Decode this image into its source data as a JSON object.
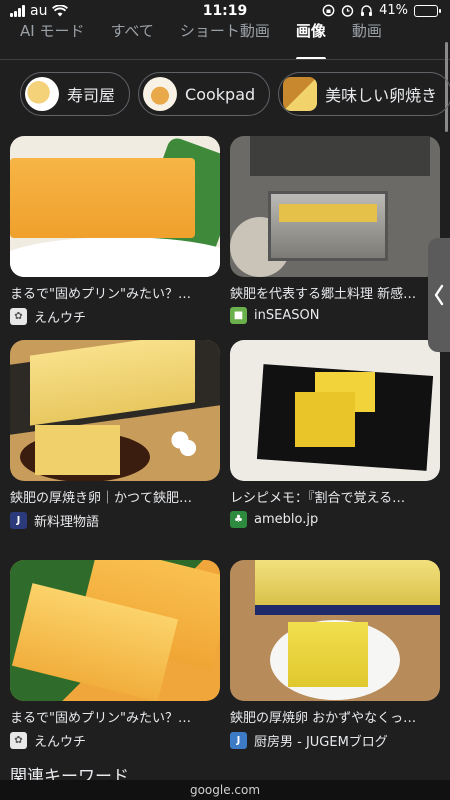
{
  "status": {
    "carrier": "au",
    "time": "11:19",
    "battery": "41%",
    "battery_level": 0.41
  },
  "tabs": [
    {
      "label": "AI モード"
    },
    {
      "label": "すべて"
    },
    {
      "label": "ショート動画"
    },
    {
      "label": "画像",
      "active": true
    },
    {
      "label": "動画"
    }
  ],
  "chips": [
    {
      "label": "寿司屋"
    },
    {
      "label": "Cookpad"
    },
    {
      "label": "美味しい卵焼き"
    }
  ],
  "results": [
    {
      "title": "まるで\"固めプリン\"みたい？…",
      "source": "えんウチ"
    },
    {
      "title": "鋏肥を代表する郷土料理 新感…",
      "source": "inSEASON"
    },
    {
      "title": "鋏肥の厚焼き卵｜かつて鋏肥…",
      "source": "新料理物語"
    },
    {
      "title": "レシピメモ：『割合で覚える…",
      "source": "ameblo.jp"
    },
    {
      "title": "まるで\"固めプリン\"みたい？…",
      "source": "えんウチ"
    },
    {
      "title": "鋏肥の厚焼卵 おかずやなくっ…",
      "source": "厨房男 - JUGEMブログ"
    }
  ],
  "related_heading": "関連キーワード",
  "url": "google.com",
  "colors": {
    "background": "#1f1f1f",
    "battery_fill": "#f5d90a"
  }
}
